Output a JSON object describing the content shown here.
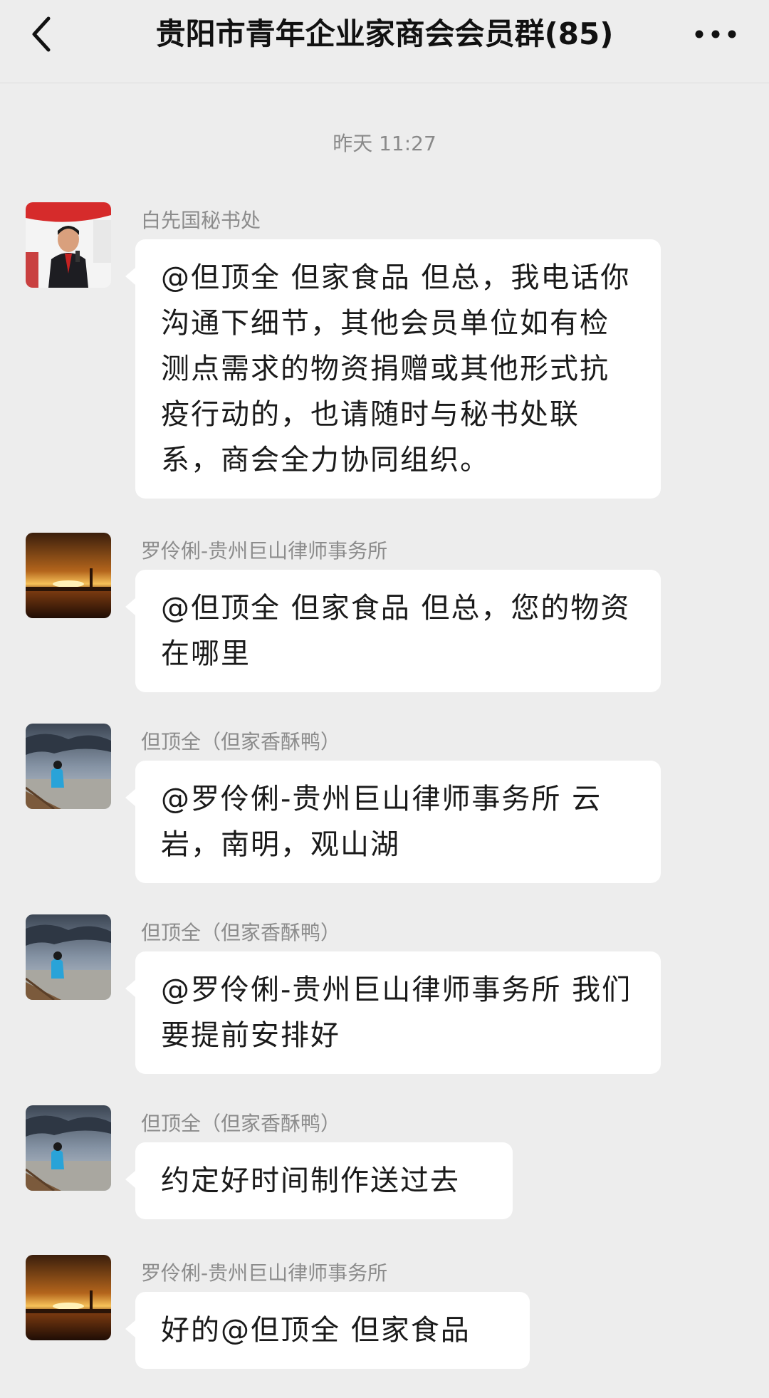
{
  "header": {
    "title": "贵阳市青年企业家商会会员群(85)",
    "back_icon": "chevron-left-icon",
    "more_icon": "more-dots-icon"
  },
  "timestamp": "昨天 11:27",
  "messages": [
    {
      "sender": "白先国秘书处",
      "text": "@但顶全 但家食品 但总，我电话你沟通下细节，其他会员单位如有检测点需求的物资捐赠或其他形式抗疫行动的，也请随时与秘书处联系，商会全力协同组织。"
    },
    {
      "sender": "罗伶俐-贵州巨山律师事务所",
      "text": "@但顶全 但家食品 但总，您的物资在哪里"
    },
    {
      "sender": "但顶全（但家香酥鸭）",
      "text": "@罗伶俐-贵州巨山律师事务所 云岩，南明，观山湖"
    },
    {
      "sender": "但顶全（但家香酥鸭）",
      "text": "@罗伶俐-贵州巨山律师事务所 我们要提前安排好"
    },
    {
      "sender": "但顶全（但家香酥鸭）",
      "text": "约定好时间制作送过去"
    },
    {
      "sender": "罗伶俐-贵州巨山律师事务所",
      "text": "好的@但顶全 但家食品"
    }
  ],
  "colors": {
    "background": "#ededed",
    "bubble": "#ffffff",
    "sender_text": "#8c8c8c"
  }
}
